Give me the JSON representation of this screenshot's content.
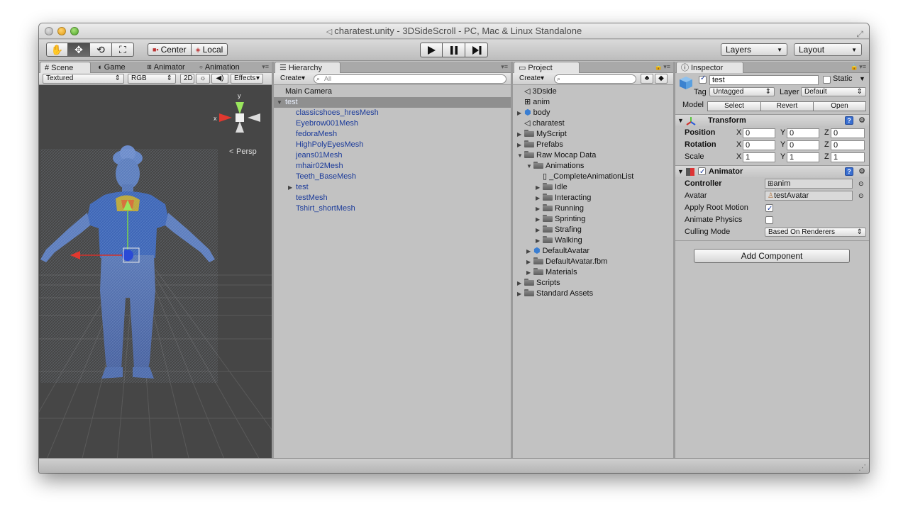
{
  "window": {
    "title": "charatest.unity - 3DSideScroll - PC, Mac & Linux Standalone"
  },
  "toolbar": {
    "pivot_center": "Center",
    "pivot_local": "Local",
    "layers": "Layers",
    "layout": "Layout"
  },
  "scene": {
    "tabs": [
      "Scene",
      "Game",
      "Animator",
      "Animation"
    ],
    "render_mode": "Textured",
    "color_mode": "RGB",
    "btn_2d": "2D",
    "effects": "Effects",
    "gizmo_y": "y",
    "gizmo_x": "x",
    "persp": "Persp"
  },
  "hierarchy": {
    "tab": "Hierarchy",
    "create": "Create",
    "search_placeholder": "All",
    "items": [
      {
        "label": "Main Camera"
      },
      {
        "label": "test"
      },
      {
        "label": "classicshoes_hresMesh"
      },
      {
        "label": "Eyebrow001Mesh"
      },
      {
        "label": "fedoraMesh"
      },
      {
        "label": "HighPolyEyesMesh"
      },
      {
        "label": "jeans01Mesh"
      },
      {
        "label": "mhair02Mesh"
      },
      {
        "label": "Teeth_BaseMesh"
      },
      {
        "label": "test"
      },
      {
        "label": "testMesh"
      },
      {
        "label": "Tshirt_shortMesh"
      }
    ]
  },
  "project": {
    "tab": "Project",
    "create": "Create",
    "items": [
      {
        "label": "3Dside"
      },
      {
        "label": "anim"
      },
      {
        "label": "body"
      },
      {
        "label": "charatest"
      },
      {
        "label": "MyScript"
      },
      {
        "label": "Prefabs"
      },
      {
        "label": "Raw Mocap Data"
      },
      {
        "label": "Animations"
      },
      {
        "label": "_CompleteAnimationList"
      },
      {
        "label": "Idle"
      },
      {
        "label": "Interacting"
      },
      {
        "label": "Running"
      },
      {
        "label": "Sprinting"
      },
      {
        "label": "Strafing"
      },
      {
        "label": "Walking"
      },
      {
        "label": "DefaultAvatar"
      },
      {
        "label": "DefaultAvatar.fbm"
      },
      {
        "label": "Materials"
      },
      {
        "label": "Scripts"
      },
      {
        "label": "Standard Assets"
      }
    ]
  },
  "inspector": {
    "tab": "Inspector",
    "object_name": "test",
    "static_label": "Static",
    "tag_label": "Tag",
    "tag_value": "Untagged",
    "layer_label": "Layer",
    "layer_value": "Default",
    "model_label": "Model",
    "model_select": "Select",
    "model_revert": "Revert",
    "model_open": "Open",
    "transform": {
      "title": "Transform",
      "position_label": "Position",
      "rotation_label": "Rotation",
      "scale_label": "Scale",
      "x": "X",
      "y": "Y",
      "z": "Z",
      "position": [
        "0",
        "0",
        "0"
      ],
      "rotation": [
        "0",
        "0",
        "0"
      ],
      "scale": [
        "1",
        "1",
        "1"
      ]
    },
    "animator": {
      "title": "Animator",
      "controller_label": "Controller",
      "controller_value": "anim",
      "avatar_label": "Avatar",
      "avatar_value": "testAvatar",
      "apply_root_motion_label": "Apply Root Motion",
      "apply_root_motion": true,
      "animate_physics_label": "Animate Physics",
      "animate_physics": false,
      "culling_mode_label": "Culling Mode",
      "culling_mode_value": "Based On Renderers"
    },
    "add_component": "Add Component"
  },
  "colors": {
    "hierarchy_child": "#1a3a9a",
    "selection": "#8f8f8f",
    "scene_bg": "#464646",
    "character": "#5a7fc0"
  }
}
